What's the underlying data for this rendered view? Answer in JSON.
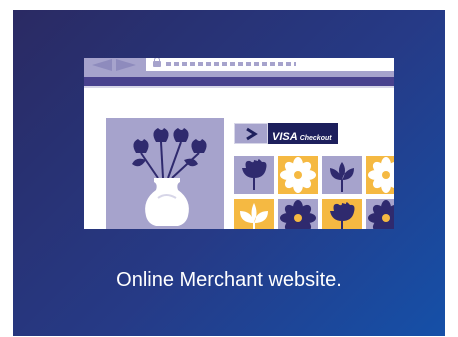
{
  "caption": "Online Merchant website.",
  "checkout": {
    "brand": "VISA",
    "label": "Checkout"
  },
  "colors": {
    "background_dark": "#2a2a63",
    "background_light": "#1550a8",
    "lavender": "#a6a3cc",
    "indigo": "#49428e",
    "yellow": "#f5b942",
    "visa_navy": "#1d1f5c"
  },
  "tiles": [
    {
      "flower": "tulip-icon",
      "bg": "lavender"
    },
    {
      "flower": "daisy-icon",
      "bg": "yellow"
    },
    {
      "flower": "lotus-icon",
      "bg": "lavender"
    },
    {
      "flower": "daisy-icon",
      "bg": "yellow"
    },
    {
      "flower": "lily-icon",
      "bg": "yellow"
    },
    {
      "flower": "daisy-icon",
      "bg": "lavender"
    },
    {
      "flower": "tulip-icon",
      "bg": "yellow"
    },
    {
      "flower": "daisy-icon",
      "bg": "lavender"
    }
  ]
}
